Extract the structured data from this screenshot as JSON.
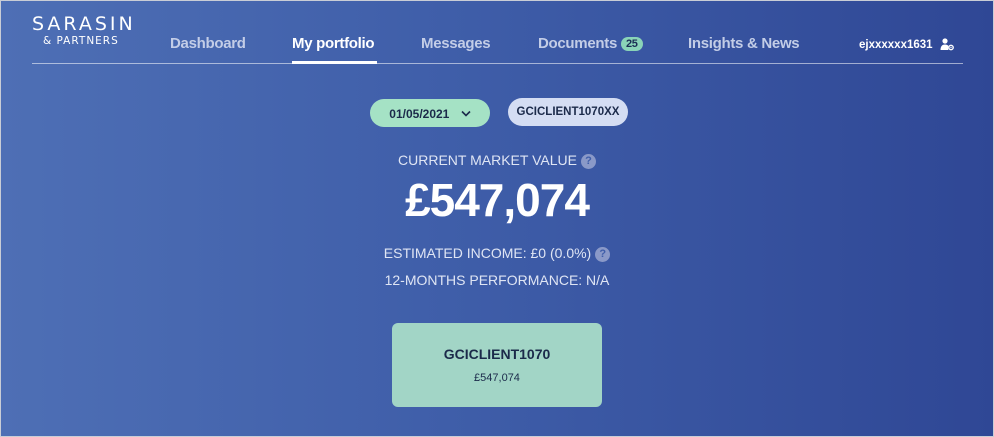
{
  "brand": {
    "name_top": "SARASIN",
    "name_bottom": "& PARTNERS"
  },
  "nav": {
    "items": [
      {
        "label": "Dashboard"
      },
      {
        "label": "My portfolio",
        "active": true
      },
      {
        "label": "Messages"
      },
      {
        "label": "Documents",
        "badge": "25"
      },
      {
        "label": "Insights & News"
      }
    ]
  },
  "user": {
    "name": "ejxxxxxx1631",
    "icon": "user-settings-icon"
  },
  "filters": {
    "date": "01/05/2021",
    "client": "GCICLIENT1070XX"
  },
  "summary": {
    "market_value_label": "CURRENT MARKET VALUE",
    "market_value": "£547,074",
    "income_text": "ESTIMATED INCOME: £0 (0.0%)",
    "performance_text": "12-MONTHS PERFORMANCE: N/A"
  },
  "accounts": [
    {
      "name": "GCICLIENT1070",
      "value": "£547,074"
    }
  ],
  "colors": {
    "background_start": "#4e6fb5",
    "background_end": "#2f4795",
    "accent_green": "#a5e2c5",
    "client_pill": "#d4ddf3",
    "card": "#a2d5c6"
  }
}
